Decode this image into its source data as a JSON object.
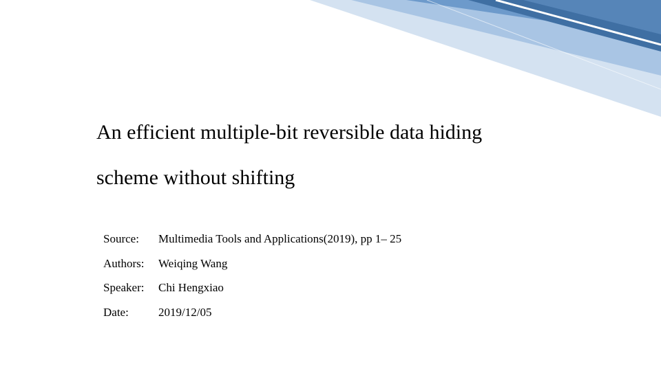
{
  "title": {
    "line1": "An efficient multiple-bit reversible data hiding",
    "line2": "scheme without shifting"
  },
  "meta": {
    "source_label": "Source:",
    "source_value": "Multimedia Tools and Applications(2019), pp 1– 25",
    "authors_label": "Authors:",
    "authors_value": "Weiqing Wang",
    "speaker_label": "Speaker:",
    "speaker_value": "Chi Hengxiao",
    "date_label": "Date:",
    "date_value": "2019/12/05"
  },
  "colors": {
    "stripe_dark": "#3f6fa3",
    "stripe_mid": "#6d9acb",
    "stripe_light1": "#a9c5e4",
    "stripe_light2": "#d4e2f1"
  }
}
